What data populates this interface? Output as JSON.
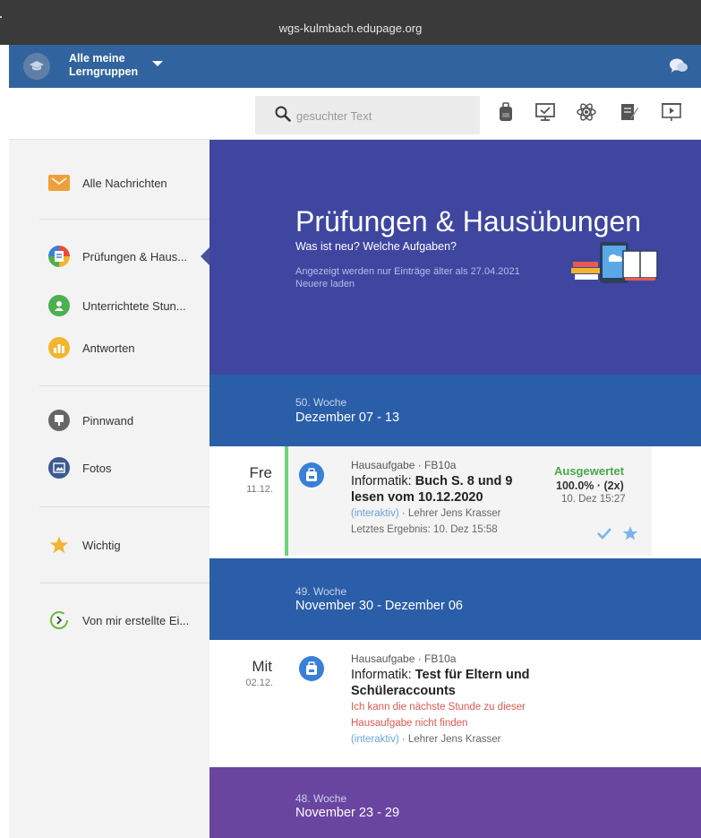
{
  "browser": {
    "url": "wgs-kulmbach.edupage.org"
  },
  "header": {
    "group_line1": "Alle meine",
    "group_line2": "Lerngruppen"
  },
  "search": {
    "placeholder": "gesuchter Text"
  },
  "toolbar_icons": [
    "homework-bag-icon",
    "teacher-board-icon",
    "atom-icon",
    "notes-icon",
    "presentation-icon"
  ],
  "sidebar": {
    "items": [
      {
        "label": "Alle Nachrichten",
        "icon": "envelope-icon",
        "color": "#f0a03a"
      },
      {
        "label": "Prüfungen & Haus...",
        "icon": "exam-icon",
        "color": "#4a6fd0"
      },
      {
        "label": "Unterrichtete Stun...",
        "icon": "lessons-icon",
        "color": "#4caf50"
      },
      {
        "label": "Antworten",
        "icon": "chart-icon",
        "color": "#f2b52f"
      },
      {
        "label": "Pinnwand",
        "icon": "pinboard-icon",
        "color": "#666666"
      },
      {
        "label": "Fotos",
        "icon": "photos-icon",
        "color": "#3d5a8f"
      },
      {
        "label": "Wichtig",
        "icon": "star-icon",
        "color": "#f2b52f"
      },
      {
        "label": "Von mir erstellte Ei...",
        "icon": "timer-icon",
        "color": "#6fb83a"
      }
    ]
  },
  "hero": {
    "title": "Prüfungen & Hausübungen",
    "subtitle": "Was ist neu? Welche Aufgaben?",
    "note_line1": "Angezeigt werden nur Einträge älter als 27.04.2021",
    "note_line2": "Neuere laden"
  },
  "weeks": [
    {
      "number": "50. Woche",
      "range": "Dezember 07 - 13",
      "color": "#2b5ea8"
    },
    {
      "number": "49. Woche",
      "range": "November 30 - Dezember 06",
      "color": "#2b5ea8"
    },
    {
      "number": "48. Woche",
      "range": "November 23 - 29",
      "color": "#6a45a0"
    }
  ],
  "entries": [
    {
      "day": "Fre",
      "date": "11.12.",
      "type": "Hausaufgabe · FB10a",
      "subject_prefix": "Informatik: ",
      "title_line1": "Buch S. 8 und 9",
      "title_line2": "lesen vom 10.12.2020",
      "interactive": "(interaktiv)",
      "teacher": " · Lehrer Jens Krasser",
      "last_result": "Letztes Ergebnis: 10. Dez 15:58",
      "status": "Ausgewertet",
      "score": "100.0% · (2x)",
      "status_time": "10. Dez 15:27"
    },
    {
      "day": "Mit",
      "date": "02.12.",
      "type": "Hausaufgabe · FB10a",
      "subject_prefix": "Informatik: ",
      "title_line1": "Test für Eltern und",
      "title_line2": "Schüleraccounts",
      "warning_line1": "Ich kann die nächste Stunde zu dieser",
      "warning_line2": "Hausaufgabe nicht finden",
      "interactive": "(interaktiv)",
      "teacher": " · Lehrer Jens Krasser"
    }
  ],
  "colors": {
    "header": "#31639e",
    "hero": "#3f46a0",
    "check": "#7cb4e6",
    "warning": "#e0594f"
  }
}
